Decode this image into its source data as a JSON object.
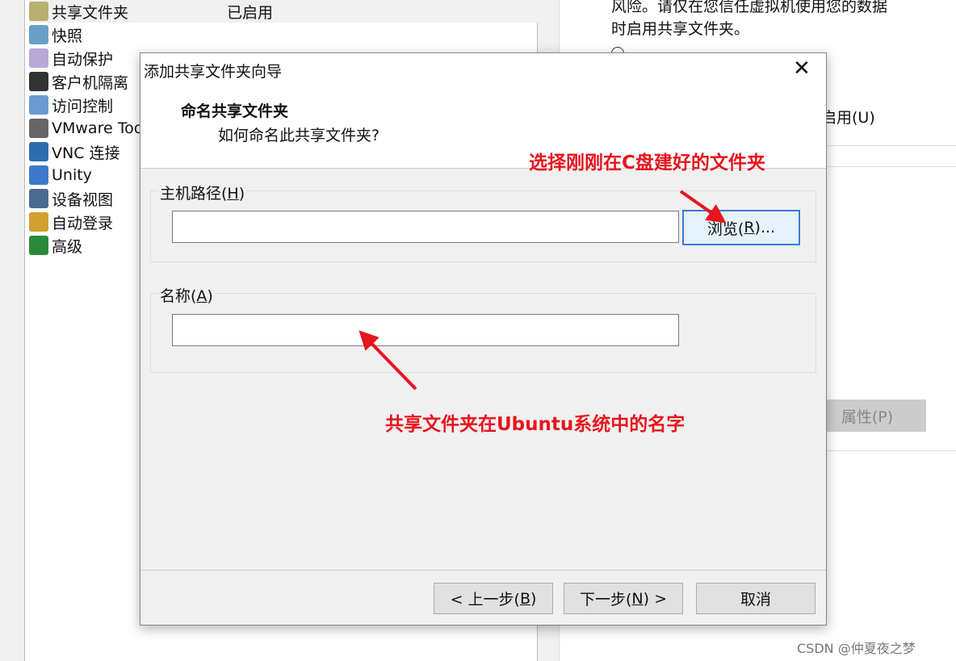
{
  "sidebar": {
    "items": [
      {
        "label": "共享文件夹",
        "value": "已启用",
        "icon": "folder-icon",
        "color": "#b8b070"
      },
      {
        "label": "快照",
        "icon": "snapshot-icon",
        "color": "#6aa0c8"
      },
      {
        "label": "自动保护",
        "icon": "autoprotect-icon",
        "color": "#b8a8d8"
      },
      {
        "label": "客户机隔离",
        "icon": "lock-icon",
        "color": "#333333"
      },
      {
        "label": "访问控制",
        "icon": "access-control-icon",
        "color": "#6a9ad0"
      },
      {
        "label": "VMware Tools",
        "icon": "vmware-icon",
        "color": "#666666"
      },
      {
        "label": "VNC 连接",
        "icon": "vnc-icon",
        "color": "#2e6cb0"
      },
      {
        "label": "Unity",
        "icon": "unity-icon",
        "color": "#3a7ac8"
      },
      {
        "label": "设备视图",
        "icon": "device-view-icon",
        "color": "#4a6a90"
      },
      {
        "label": "自动登录",
        "icon": "autologin-icon",
        "color": "#d0a030"
      },
      {
        "label": "高级",
        "icon": "advanced-icon",
        "color": "#2a8a3a"
      }
    ]
  },
  "right": {
    "line1": "风险。请仅在您信任虚拟机使用您的数据",
    "line2": "时启用共享文件夹。",
    "option_enable": "启用(U)",
    "properties_button": "属性(P)"
  },
  "dialog": {
    "title": "添加共享文件夹向导",
    "heading": "命名共享文件夹",
    "subheading": "如何命名此共享文件夹?",
    "host_path_label": "主机路径(",
    "host_path_key": "H",
    "host_path_value": "",
    "browse_label": "浏览(",
    "browse_key": "R",
    "browse_suffix": ")...",
    "name_label": "名称(",
    "name_key": "A",
    "name_value": "",
    "back_prefix": "< 上一步(",
    "back_key": "B",
    "back_suffix": ")",
    "next_prefix": "下一步(",
    "next_key": "N",
    "next_suffix": ") >",
    "cancel": "取消"
  },
  "annotations": {
    "browse_note": "选择刚刚在C盘建好的文件夹",
    "name_note": "共享文件夹在Ubuntu系统中的名字",
    "color": "#e8141e"
  },
  "watermark": "CSDN @仲夏夜之梦"
}
